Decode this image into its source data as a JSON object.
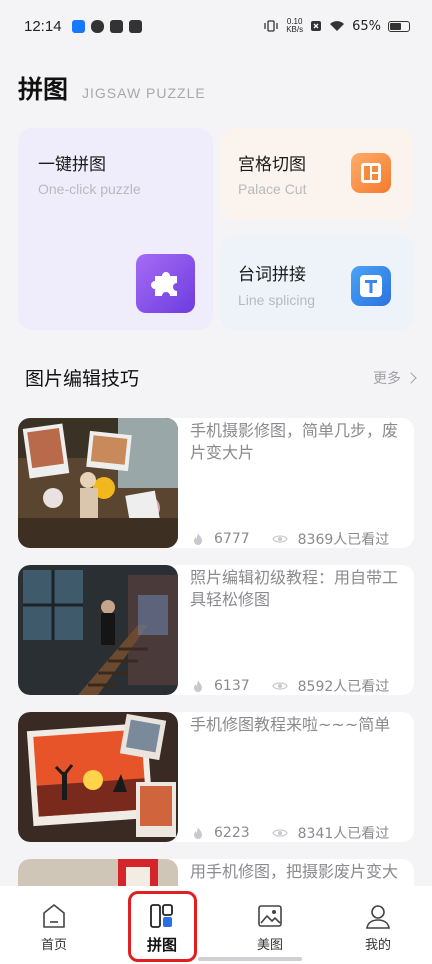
{
  "status": {
    "time": "12:14",
    "net_top": "0.10",
    "net_bottom": "KB/s",
    "battery": "65%"
  },
  "header": {
    "title": "拼图",
    "subtitle": "JIGSAW PUZZLE"
  },
  "features": {
    "one_click": {
      "title": "一键拼图",
      "en": "One-click puzzle",
      "icon": "puzzle-piece-icon"
    },
    "palace": {
      "title": "宫格切图",
      "en": "Palace Cut",
      "icon": "grid-layout-icon"
    },
    "line": {
      "title": "台词拼接",
      "en": "Line splicing",
      "icon": "text-t-icon"
    }
  },
  "section": {
    "title": "图片编辑技巧",
    "more": "更多"
  },
  "articles": [
    {
      "title": "手机摄影修图，简单几步，废片变大片",
      "likes": "6777",
      "views": "8369人已看过"
    },
    {
      "title": "照片编辑初级教程：用自带工具轻松修图",
      "likes": "6137",
      "views": "8592人已看过"
    },
    {
      "title": "手机修图教程来啦~~~简单",
      "likes": "6223",
      "views": "8341人已看过"
    },
    {
      "title": "用手机修图，把摄影废片变大"
    }
  ],
  "nav": [
    {
      "label": "首页",
      "icon": "home-icon"
    },
    {
      "label": "拼图",
      "icon": "collage-icon"
    },
    {
      "label": "美图",
      "icon": "image-icon"
    },
    {
      "label": "我的",
      "icon": "user-icon"
    }
  ],
  "colors": {
    "accent_purple": "#7a4be6",
    "palace_orange": "#f58a3c",
    "text_blue": "#3b86ea",
    "highlight_red": "#e02020"
  }
}
